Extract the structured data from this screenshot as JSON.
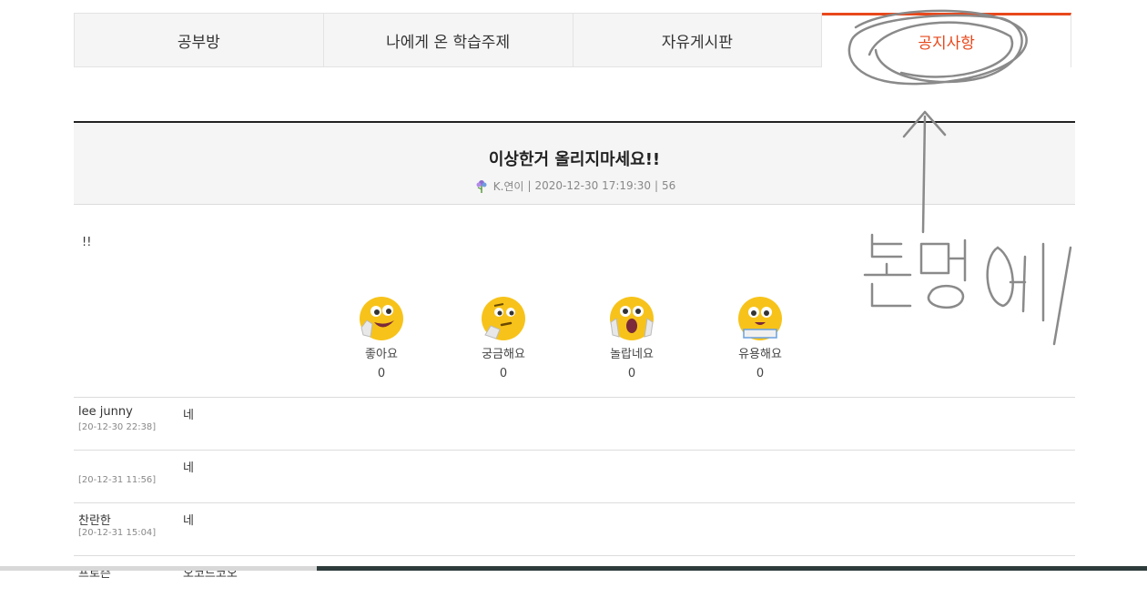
{
  "tabs": [
    {
      "label": "공부방"
    },
    {
      "label": "나에게 온 학습주제"
    },
    {
      "label": "자유게시판"
    },
    {
      "label": "공지사항",
      "active": true
    }
  ],
  "post": {
    "title": "이상한거 올리지마세요!!",
    "author": "K.연이",
    "datetime": "2020-12-30 17:19:30",
    "views": "56",
    "body": "!!"
  },
  "reactions": [
    {
      "label": "좋아요",
      "count": "0",
      "icon": "thumb-face-icon"
    },
    {
      "label": "궁금해요",
      "count": "0",
      "icon": "thinking-face-icon"
    },
    {
      "label": "놀랍네요",
      "count": "0",
      "icon": "surprised-face-icon"
    },
    {
      "label": "유용해요",
      "count": "0",
      "icon": "book-face-icon"
    }
  ],
  "comments": [
    {
      "author": "lee junny",
      "date": "[20-12-30 22:38]",
      "text": "네"
    },
    {
      "author": "",
      "date": "[20-12-31 11:56]",
      "text": "네"
    },
    {
      "author": "찬란한",
      "date": "[20-12-31 15:04]",
      "text": "네"
    },
    {
      "author": "프로즌",
      "date": "",
      "text": "오코드코오"
    }
  ],
  "annotation": {
    "handwritten_text": "분명히"
  },
  "colors": {
    "accent": "#e8481c",
    "emoji": "#f7c31a",
    "header_bg": "#f5f5f5"
  }
}
